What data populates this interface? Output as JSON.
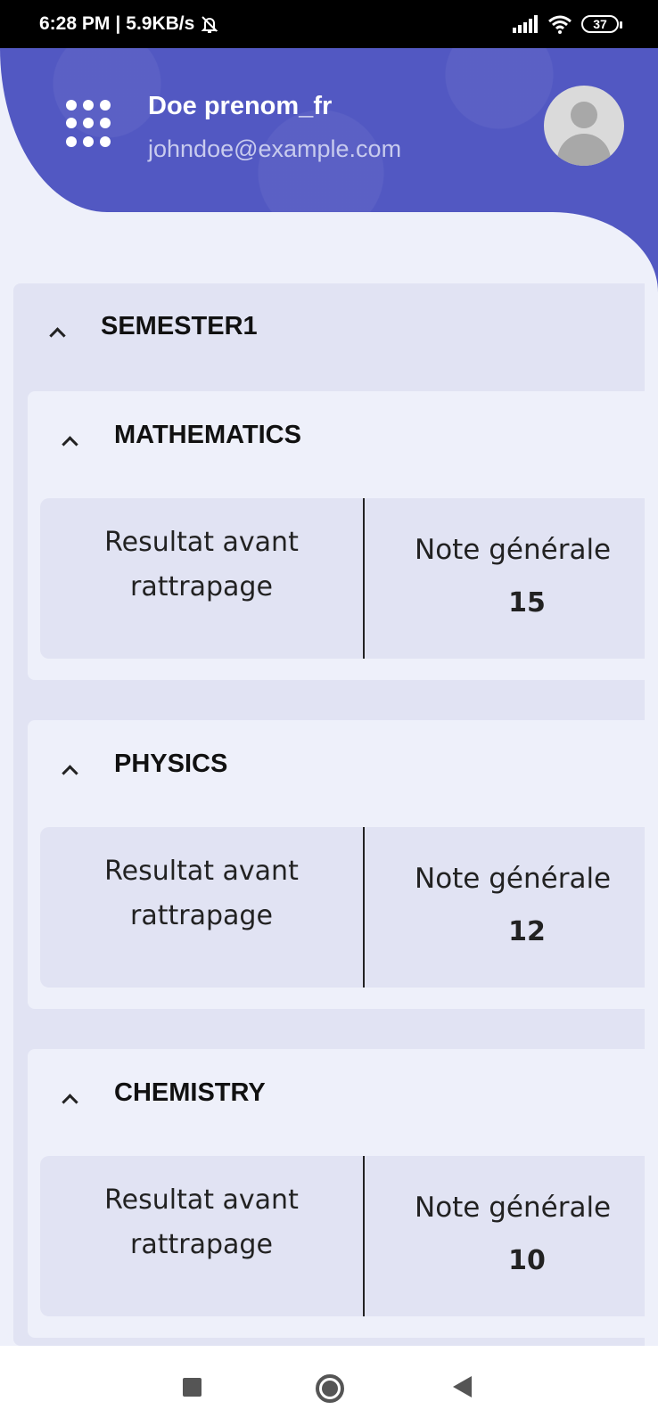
{
  "status_bar": {
    "time": "6:28 PM",
    "separator": "|",
    "network_speed": "5.9KB/s",
    "battery": "37"
  },
  "header": {
    "user_name": "Doe prenom_fr",
    "user_email": "johndoe@example.com",
    "menu_icon": "grid-dots-icon",
    "avatar_icon": "user-avatar-icon",
    "colors": {
      "header_bg": "#5258c2",
      "page_bg": "#eef0fa",
      "card_bg": "#e1e3f3"
    }
  },
  "semester": {
    "title": "SEMESTER1",
    "courses": [
      {
        "title": "MATHEMATICS",
        "result_label": "Resultat avant rattrapage",
        "note_label": "Note générale",
        "note_value": "15"
      },
      {
        "title": "PHYSICS",
        "result_label": "Resultat avant rattrapage",
        "note_label": "Note générale",
        "note_value": "12"
      },
      {
        "title": "CHEMISTRY",
        "result_label": "Resultat avant rattrapage",
        "note_label": "Note générale",
        "note_value": "10"
      }
    ]
  },
  "nav_bar": {
    "recents_icon": "square-recents-icon",
    "home_icon": "circle-home-icon",
    "back_icon": "triangle-back-icon"
  }
}
